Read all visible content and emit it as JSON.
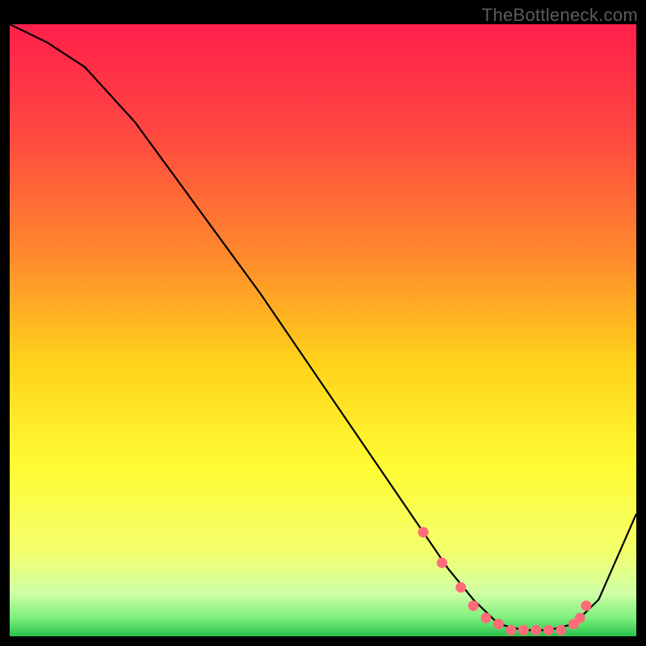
{
  "watermark": "TheBottleneck.com",
  "colors": {
    "gradient_stops": [
      {
        "offset": 0.0,
        "color": "#ff1f4b"
      },
      {
        "offset": 0.18,
        "color": "#ff4840"
      },
      {
        "offset": 0.38,
        "color": "#ff8a2c"
      },
      {
        "offset": 0.55,
        "color": "#ffd21a"
      },
      {
        "offset": 0.72,
        "color": "#fffb33"
      },
      {
        "offset": 0.86,
        "color": "#f4ff6b"
      },
      {
        "offset": 0.93,
        "color": "#cfffa6"
      },
      {
        "offset": 0.97,
        "color": "#7cf07c"
      },
      {
        "offset": 1.0,
        "color": "#27c24c"
      }
    ],
    "curve": "#000000",
    "marker_fill": "#ff6b78",
    "marker_stroke": "#ff6b78"
  },
  "chart_data": {
    "type": "line",
    "title": "",
    "xlabel": "",
    "ylabel": "",
    "xlim": [
      0,
      100
    ],
    "ylim": [
      0,
      100
    ],
    "grid": false,
    "legend": false,
    "series": [
      {
        "name": "curve",
        "x": [
          0,
          6,
          12,
          20,
          30,
          40,
          50,
          60,
          66,
          70,
          74,
          78,
          82,
          86,
          90,
          94,
          100
        ],
        "y": [
          100,
          97,
          93,
          84,
          70,
          56,
          41,
          26,
          17,
          11,
          6,
          2,
          1,
          1,
          2,
          6,
          20
        ]
      }
    ],
    "markers": {
      "name": "valley-markers",
      "x": [
        66,
        69,
        72,
        74,
        76,
        78,
        80,
        82,
        84,
        86,
        88,
        90,
        91,
        92
      ],
      "y": [
        17,
        12,
        8,
        5,
        3,
        2,
        1,
        1,
        1,
        1,
        1,
        2,
        3,
        5
      ]
    }
  }
}
